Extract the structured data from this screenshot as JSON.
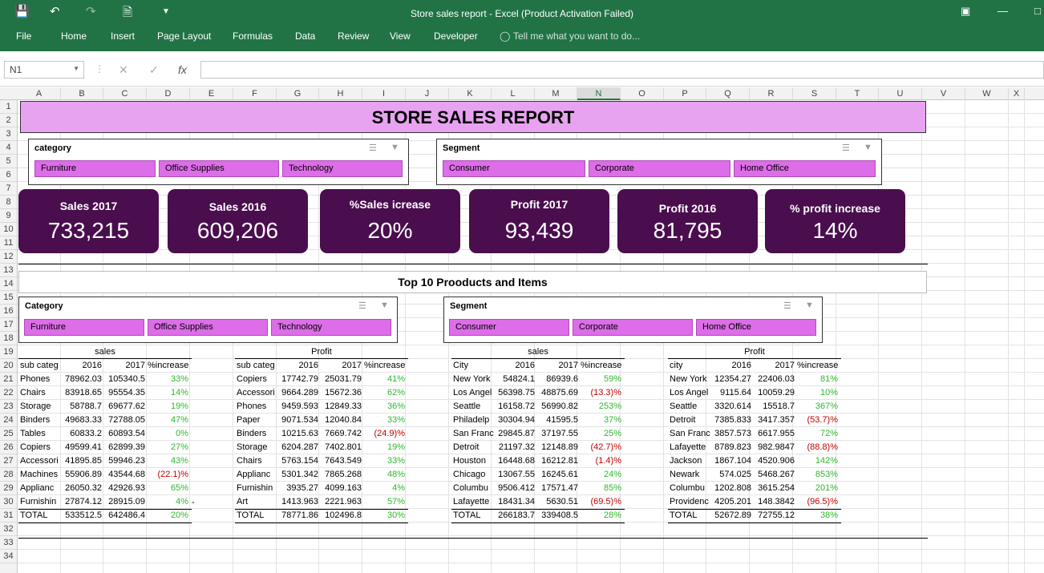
{
  "window": {
    "title": "Store sales report - Excel (Product Activation Failed)"
  },
  "menu": [
    "File",
    "Home",
    "Insert",
    "Page Layout",
    "Formulas",
    "Data",
    "Review",
    "View",
    "Developer"
  ],
  "tell_me": "Tell me what you want to do...",
  "name_box": "N1",
  "columns": [
    "A",
    "B",
    "C",
    "D",
    "E",
    "F",
    "G",
    "H",
    "I",
    "J",
    "K",
    "L",
    "M",
    "N",
    "O",
    "P",
    "Q",
    "R",
    "S",
    "T",
    "U",
    "V",
    "W",
    "X"
  ],
  "rows": [
    "1",
    "2",
    "3",
    "4",
    "5",
    "6",
    "7",
    "8",
    "9",
    "10",
    "11",
    "12",
    "13",
    "14",
    "15",
    "16",
    "17",
    "18",
    "19",
    "20",
    "21",
    "22",
    "23",
    "24",
    "25",
    "26",
    "27",
    "28",
    "29",
    "30",
    "31",
    "32",
    "33",
    "34"
  ],
  "banner": "STORE SALES REPORT",
  "slicers": {
    "top_category": {
      "header": "category",
      "items": [
        "Furniture",
        "Office Supplies",
        "Technology"
      ]
    },
    "top_segment": {
      "header": "Segment",
      "items": [
        "Consumer",
        "Corporate",
        "Home Office"
      ]
    },
    "mid_category": {
      "header": "Category",
      "items": [
        "Furniture",
        "Office Supplies",
        "Technology"
      ]
    },
    "mid_segment": {
      "header": "Segment",
      "items": [
        "Consumer",
        "Corporate",
        "Home Office"
      ]
    }
  },
  "cards": [
    {
      "label": "Sales 2017",
      "value": "733,215"
    },
    {
      "label": "Sales 2016",
      "value": "609,206"
    },
    {
      "label": "%Sales icrease",
      "value": "20%"
    },
    {
      "label": "Profit 2017",
      "value": "93,439"
    },
    {
      "label": "Profit 2016",
      "value": "81,795"
    },
    {
      "label": "% profit increase",
      "value": "14%"
    }
  ],
  "top10": "Top 10 Prooducts and Items",
  "tables": [
    {
      "caption": "sales",
      "headers": [
        "sub categ",
        "2016",
        "2017",
        "%increase"
      ],
      "rows": [
        [
          "Phones",
          "78962.03",
          "105340.5",
          "33%"
        ],
        [
          "Chairs",
          "83918.65",
          "95554.35",
          "14%"
        ],
        [
          "Storage",
          "58788.7",
          "69677.62",
          "19%"
        ],
        [
          "Binders",
          "49683.33",
          "72788.05",
          "47%"
        ],
        [
          "Tables",
          "60833.2",
          "60893.54",
          "0%"
        ],
        [
          "Copiers",
          "49599.41",
          "62899.39",
          "27%"
        ],
        [
          "Accessori",
          "41895.85",
          "59946.23",
          "43%"
        ],
        [
          "Machines",
          "55906.89",
          "43544.68",
          "(22.1)%"
        ],
        [
          "Applianc",
          "26050.32",
          "42926.93",
          "65%"
        ],
        [
          "Furnishin",
          "27874.12",
          "28915.09",
          "4%"
        ]
      ],
      "total": [
        "TOTAL",
        "533512.5",
        "642486.4",
        "20%"
      ]
    },
    {
      "caption": "Profit",
      "headers": [
        "sub categ",
        "2016",
        "2017",
        "%increase"
      ],
      "rows": [
        [
          "Copiers",
          "17742.79",
          "25031.79",
          "41%"
        ],
        [
          "Accessori",
          "9664.289",
          "15672.36",
          "62%"
        ],
        [
          "Phones",
          "9459.593",
          "12849.33",
          "36%"
        ],
        [
          "Paper",
          "9071.534",
          "12040.84",
          "33%"
        ],
        [
          "Binders",
          "10215.63",
          "7669.742",
          "(24.9)%"
        ],
        [
          "Storage",
          "6204.287",
          "7402.801",
          "19%"
        ],
        [
          "Chairs",
          "5763.154",
          "7643.549",
          "33%"
        ],
        [
          "Applianc",
          "5301.342",
          "7865.268",
          "48%"
        ],
        [
          "Furnishin",
          "3935.27",
          "4099.163",
          "4%"
        ],
        [
          "Art",
          "1413.963",
          "2221.963",
          "57%"
        ]
      ],
      "total": [
        "TOTAL",
        "78771.86",
        "102496.8",
        "30%"
      ]
    },
    {
      "caption": "sales",
      "headers": [
        "City",
        "2016",
        "2017",
        "%increase"
      ],
      "rows": [
        [
          "New York",
          "54824.1",
          "86939.6",
          "59%"
        ],
        [
          "Los Angel",
          "56398.75",
          "48875.69",
          "(13.3)%"
        ],
        [
          "Seattle",
          "16158.72",
          "56990.82",
          "253%"
        ],
        [
          "Philadelp",
          "30304.94",
          "41595.5",
          "37%"
        ],
        [
          "San Franc",
          "29845.87",
          "37197.55",
          "25%"
        ],
        [
          "Detroit",
          "21197.32",
          "12148.89",
          "(42.7)%"
        ],
        [
          "Houston",
          "16448.68",
          "16212.81",
          "(1.4)%"
        ],
        [
          "Chicago",
          "13067.55",
          "16245.61",
          "24%"
        ],
        [
          "Columbu",
          "9506.412",
          "17571.47",
          "85%"
        ],
        [
          "Lafayette",
          "18431.34",
          "5630.51",
          "(69.5)%"
        ]
      ],
      "total": [
        "TOTAL",
        "266183.7",
        "339408.5",
        "28%"
      ]
    },
    {
      "caption": "Profit",
      "headers": [
        "city",
        "2016",
        "2017",
        "%increase"
      ],
      "rows": [
        [
          "New York",
          "12354.27",
          "22406.03",
          "81%"
        ],
        [
          "Los Angel",
          "9115.64",
          "10059.29",
          "10%"
        ],
        [
          "Seattle",
          "3320.614",
          "15518.7",
          "367%"
        ],
        [
          "Detroit",
          "7385.833",
          "3417.357",
          "(53.7)%"
        ],
        [
          "San Franc",
          "3857.573",
          "6617.955",
          "72%"
        ],
        [
          "Lafayette",
          "8789.823",
          "982.9847",
          "(88.8)%"
        ],
        [
          "Jackson",
          "1867.104",
          "4520.906",
          "142%"
        ],
        [
          "Newark",
          "574.025",
          "5468.267",
          "853%"
        ],
        [
          "Columbu",
          "1202.808",
          "3615.254",
          "201%"
        ],
        [
          "Providenc",
          "4205.201",
          "148.3842",
          "(96.5)%"
        ]
      ],
      "total": [
        "TOTAL",
        "52672.89",
        "72755.12",
        "38%"
      ]
    }
  ],
  "stray_dash": "-",
  "colors": {
    "excel_green": "#217346",
    "banner": "#e8a3f0",
    "card": "#4a0e4e",
    "slicer_btn": "#dd6de8",
    "positive": "#2eb82e",
    "negative": "#c00000"
  }
}
